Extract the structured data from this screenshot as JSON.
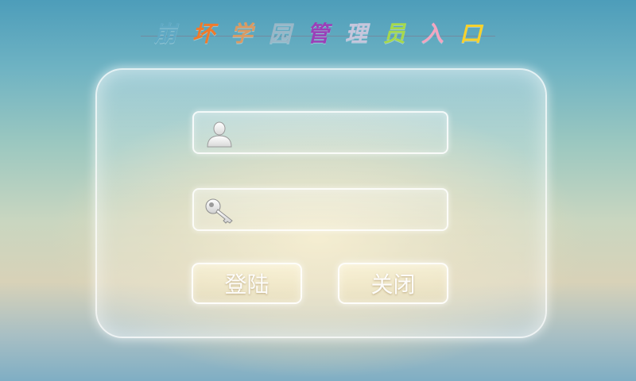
{
  "title": {
    "chars": [
      {
        "text": "崩",
        "color": "#5fa9c4"
      },
      {
        "text": "坏",
        "color": "#f07a2a"
      },
      {
        "text": "学",
        "color": "#d99a63"
      },
      {
        "text": "园",
        "color": "#9ab7c7"
      },
      {
        "text": "管",
        "color": "#9b3fb8"
      },
      {
        "text": "理",
        "color": "#c7c6dc"
      },
      {
        "text": "员",
        "color": "#a6d94c"
      },
      {
        "text": "入",
        "color": "#f3a5c0"
      },
      {
        "text": "口",
        "color": "#f7d12c"
      }
    ]
  },
  "form": {
    "username": {
      "value": "",
      "placeholder": ""
    },
    "password": {
      "value": "",
      "placeholder": ""
    },
    "login_label": "登陆",
    "close_label": "关闭"
  },
  "icons": {
    "username": "user-icon",
    "password": "key-icon"
  }
}
